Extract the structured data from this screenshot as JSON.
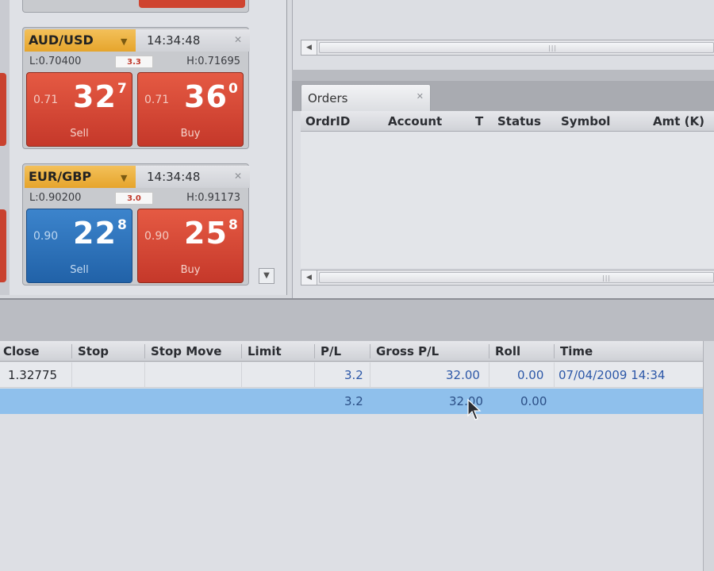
{
  "tiles": [
    {
      "pair": "AUD/USD",
      "time": "14:34:48",
      "low": "L:0.70400",
      "spread": "3.3",
      "high": "H:0.71695",
      "sell": {
        "small": "0.71",
        "big": "32",
        "sup": "7",
        "label": "Sell"
      },
      "buy": {
        "small": "0.71",
        "big": "36",
        "sup": "0",
        "label": "Buy"
      }
    },
    {
      "pair": "EUR/GBP",
      "time": "14:34:48",
      "low": "L:0.90200",
      "spread": "3.0",
      "high": "H:0.91173",
      "sell": {
        "small": "0.90",
        "big": "22",
        "sup": "8",
        "label": "Sell"
      },
      "buy": {
        "small": "0.90",
        "big": "25",
        "sup": "8",
        "label": "Buy"
      }
    }
  ],
  "orders": {
    "tab_label": "Orders",
    "columns": [
      "OrdrID",
      "Account",
      "T",
      "Status",
      "Symbol",
      "Amt (K)"
    ]
  },
  "positions": {
    "columns": [
      "Close",
      "Stop",
      "Stop Move",
      "Limit",
      "P/L",
      "Gross P/L",
      "Roll",
      "Time"
    ],
    "rows": [
      {
        "close": "1.32775",
        "pl": "3.2",
        "gross": "32.00",
        "roll": "0.00",
        "time": "07/04/2009 14:34"
      },
      {
        "close": "",
        "pl": "3.2",
        "gross": "32.00",
        "roll": "0.00",
        "time": ""
      }
    ]
  },
  "colors": {
    "sell_red": "#d2452f",
    "sell_blue": "#2f73bb",
    "selected_row": "#8fc0ec",
    "pair_header": "#eab13c"
  }
}
